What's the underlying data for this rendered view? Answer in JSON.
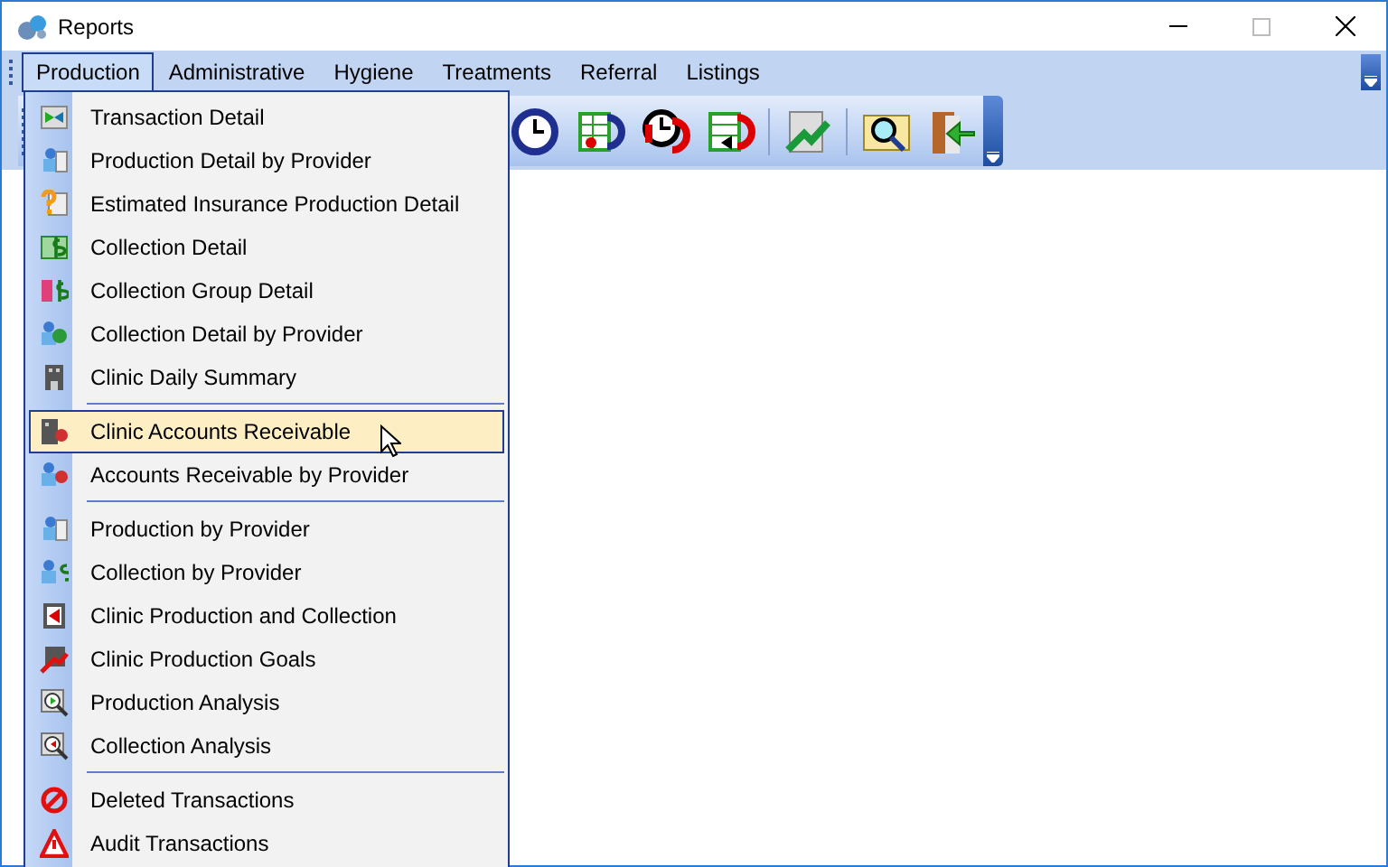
{
  "window": {
    "title": "Reports"
  },
  "menu_bar": [
    {
      "label": "Production",
      "selected": true
    },
    {
      "label": "Administrative",
      "selected": false
    },
    {
      "label": "Hygiene",
      "selected": false
    },
    {
      "label": "Treatments",
      "selected": false
    },
    {
      "label": "Referral",
      "selected": false
    },
    {
      "label": "Listings",
      "selected": false
    }
  ],
  "menu": {
    "groups": [
      [
        {
          "label": "Transaction Detail",
          "selected": false
        },
        {
          "label": "Production Detail by Provider",
          "selected": false
        },
        {
          "label": "Estimated Insurance Production Detail",
          "selected": false
        },
        {
          "label": "Collection Detail",
          "selected": false
        },
        {
          "label": "Collection Group Detail",
          "selected": false
        },
        {
          "label": "Collection Detail by Provider",
          "selected": false
        },
        {
          "label": "Clinic Daily Summary",
          "selected": false
        }
      ],
      [
        {
          "label": "Clinic Accounts Receivable",
          "selected": true
        },
        {
          "label": "Accounts Receivable by Provider",
          "selected": false
        }
      ],
      [
        {
          "label": "Production by Provider",
          "selected": false
        },
        {
          "label": "Collection by Provider",
          "selected": false
        },
        {
          "label": "Clinic Production and Collection",
          "selected": false
        },
        {
          "label": "Clinic Production Goals",
          "selected": false
        },
        {
          "label": "Production Analysis",
          "selected": false
        },
        {
          "label": "Collection Analysis",
          "selected": false
        }
      ],
      [
        {
          "label": "Deleted Transactions",
          "selected": false
        },
        {
          "label": "Audit Transactions",
          "selected": false
        }
      ]
    ]
  }
}
